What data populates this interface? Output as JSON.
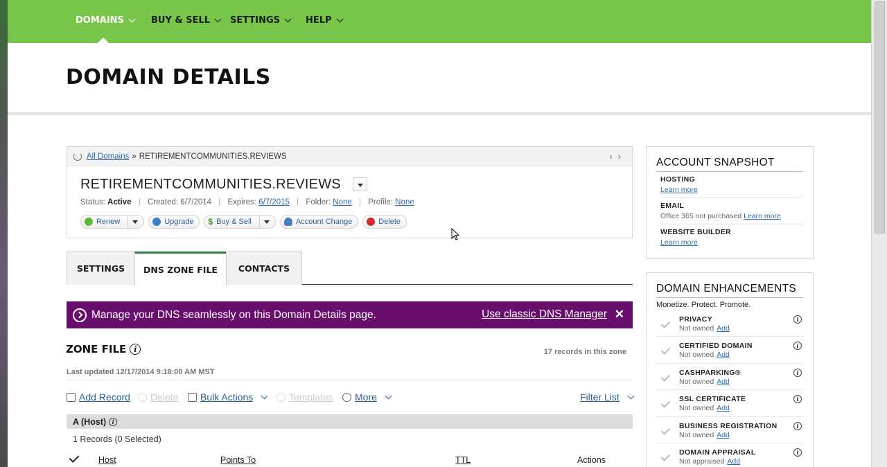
{
  "nav": {
    "items": [
      {
        "label": "DOMAINS",
        "active": true
      },
      {
        "label": "BUY & SELL",
        "active": false
      },
      {
        "label": "SETTINGS",
        "active": false
      },
      {
        "label": "HELP",
        "active": false
      }
    ]
  },
  "page": {
    "title": "DOMAIN DETAILS"
  },
  "domain": {
    "breadcrumb_link": "All Domains",
    "breadcrumb_sep": "»",
    "breadcrumb_current": "RETIREMENTCOMMUNITIES.REVIEWS",
    "name": "RETIREMENTCOMMUNITIES.REVIEWS",
    "status_label": "Status:",
    "status_value": "Active",
    "created_label": "Created:",
    "created_value": "6/7/2014",
    "expires_label": "Expires:",
    "expires_value": "6/7/2015",
    "folder_label": "Folder:",
    "folder_value": "None",
    "profile_label": "Profile:",
    "profile_value": "None",
    "actions": {
      "renew": "Renew",
      "upgrade": "Upgrade",
      "buy_sell": "Buy & Sell",
      "account_change": "Account Change",
      "delete": "Delete"
    }
  },
  "tabs": [
    {
      "label": "SETTINGS",
      "active": false
    },
    {
      "label": "DNS ZONE FILE",
      "active": true
    },
    {
      "label": "CONTACTS",
      "active": false
    }
  ],
  "banner": {
    "message": "Manage your DNS seamlessly on this Domain Details page.",
    "link": "Use classic DNS Manager",
    "close": "✕",
    "color": "#6a0e6e"
  },
  "zone": {
    "title": "ZONE FILE",
    "records_count": "17 records in this zone",
    "last_updated": "Last updated 12/17/2014 9:18:00 AM MST",
    "toolbar": {
      "add_record": "Add Record",
      "delete": "Delete",
      "bulk_actions": "Bulk Actions",
      "templates": "Templates",
      "more": "More",
      "filter_list": "Filter List"
    },
    "host_section": "A (Host)",
    "records_selected": "1 Records (0 Selected)",
    "columns": {
      "host": "Host",
      "points_to": "Points To",
      "ttl": "TTL",
      "actions": "Actions"
    }
  },
  "snapshot": {
    "title": "ACCOUNT SNAPSHOT",
    "items": [
      {
        "title": "HOSTING",
        "sub": "",
        "link": "Learn more"
      },
      {
        "title": "EMAIL",
        "sub": "Office 365 not purchased",
        "link": "Learn more"
      },
      {
        "title": "WEBSITE BUILDER",
        "sub": "",
        "link": "Learn more"
      }
    ]
  },
  "enhancements": {
    "title": "DOMAIN ENHANCEMENTS",
    "subtitle": "Monetize. Protect. Promote.",
    "items": [
      {
        "title": "PRIVACY",
        "status": "Not owned",
        "link": "Add"
      },
      {
        "title": "CERTIFIED DOMAIN",
        "status": "Not owned",
        "link": "Add"
      },
      {
        "title": "CASHPARKING®",
        "status": "Not owned",
        "link": "Add"
      },
      {
        "title": "SSL CERTIFICATE",
        "status": "Not owned",
        "link": "Add"
      },
      {
        "title": "BUSINESS REGISTRATION",
        "status": "Not owned",
        "link": "Add"
      },
      {
        "title": "DOMAIN APPRAISAL",
        "status": "Not appraised",
        "link": "Add"
      }
    ]
  },
  "colors": {
    "nav_green": "#77c64a",
    "tab_active_border": "#2e7d3e",
    "link_blue": "#2a6db0"
  }
}
